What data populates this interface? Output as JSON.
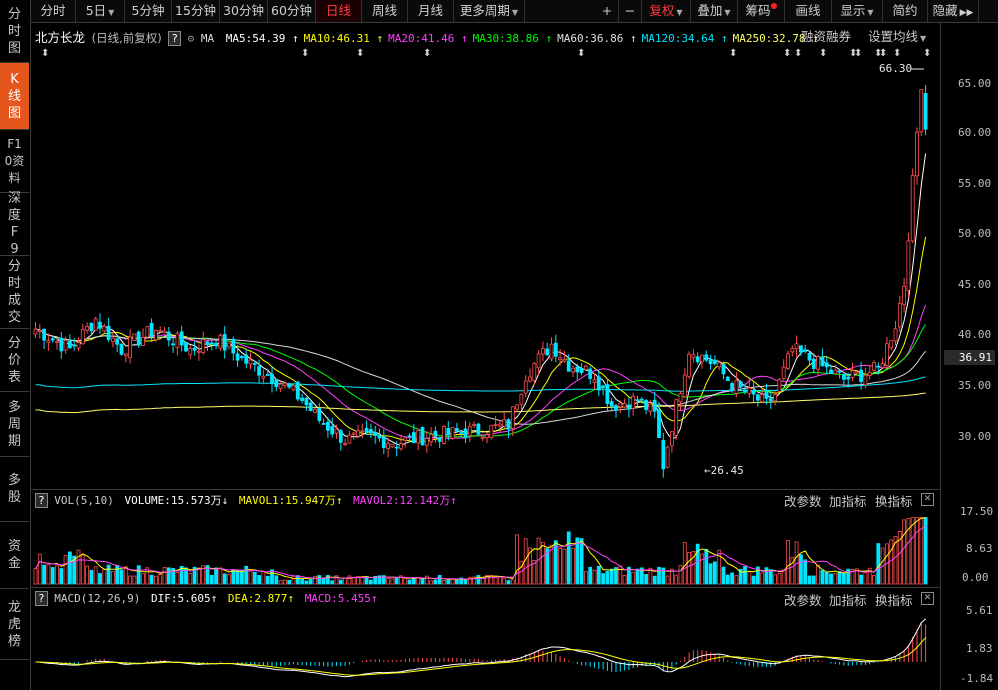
{
  "sidebar": {
    "items": [
      {
        "label": "分时图"
      },
      {
        "label": "K线图"
      },
      {
        "label": "F10资料"
      },
      {
        "label": "深度F9"
      },
      {
        "label": "分时成交"
      },
      {
        "label": "分价表"
      },
      {
        "label": "多周期"
      },
      {
        "label": "多股"
      },
      {
        "label": "资金"
      },
      {
        "label": "龙虎榜"
      }
    ]
  },
  "toolbar": {
    "periods": [
      "分时",
      "5日",
      "5分钟",
      "15分钟",
      "30分钟",
      "60分钟",
      "日线",
      "周线",
      "月线",
      "更多周期"
    ],
    "right": [
      "+",
      "−",
      "复权",
      "叠加",
      "筹码",
      "画线",
      "显示",
      "简约",
      "隐藏"
    ]
  },
  "main_legend": {
    "stock_name": "北方长龙",
    "mode": "(日线,前复权)",
    "help": "?",
    "ma_label": "MA",
    "items": [
      {
        "text": "MA5:54.39",
        "arrow": "↑",
        "color": "#ffffff"
      },
      {
        "text": "MA10:46.31",
        "arrow": "↑",
        "color": "#ffff00"
      },
      {
        "text": "MA20:41.46",
        "arrow": "↑",
        "color": "#ff40ff"
      },
      {
        "text": "MA30:38.86",
        "arrow": "↑",
        "color": "#00ff00"
      },
      {
        "text": "MA60:36.86",
        "arrow": "↑",
        "color": "#e0e0e0"
      },
      {
        "text": "MA120:34.64",
        "arrow": "↑",
        "color": "#00e5ff"
      },
      {
        "text": "MA250:32.78",
        "arrow": "↑",
        "color": "#ffff66"
      }
    ],
    "margin_trading": "融资融券",
    "setting": "设置均线"
  },
  "price_axis": {
    "labels": [
      "65.00",
      "60.00",
      "55.00",
      "50.00",
      "45.00",
      "40.00",
      "35.00",
      "30.00"
    ],
    "current": "36.91"
  },
  "annotations": {
    "high": "66.30",
    "low": "26.45"
  },
  "vol_legend": {
    "name": "VOL(5,10)",
    "volume": "VOLUME:15.573万",
    "volume_arrow": "↓",
    "mavol1": "MAVOL1:15.947万",
    "mavol1_arrow": "↑",
    "mavol2": "MAVOL2:12.142万",
    "mavol2_arrow": "↑",
    "actions": [
      "改参数",
      "加指标",
      "换指标"
    ],
    "axis": [
      "17.50",
      "8.63",
      "0.00"
    ]
  },
  "macd_legend": {
    "name": "MACD(12,26,9)",
    "dif": "DIF:5.605",
    "dif_arrow": "↑",
    "dea": "DEA:2.877",
    "dea_arrow": "↑",
    "macd": "MACD:5.455",
    "macd_arrow": "↑",
    "actions": [
      "改参数",
      "加指标",
      "换指标"
    ],
    "axis": [
      "5.61",
      "1.83",
      "-1.84"
    ]
  },
  "colors": {
    "up": "#ff4d4d",
    "down": "#00e5ff",
    "accent": "#e4561c"
  }
}
